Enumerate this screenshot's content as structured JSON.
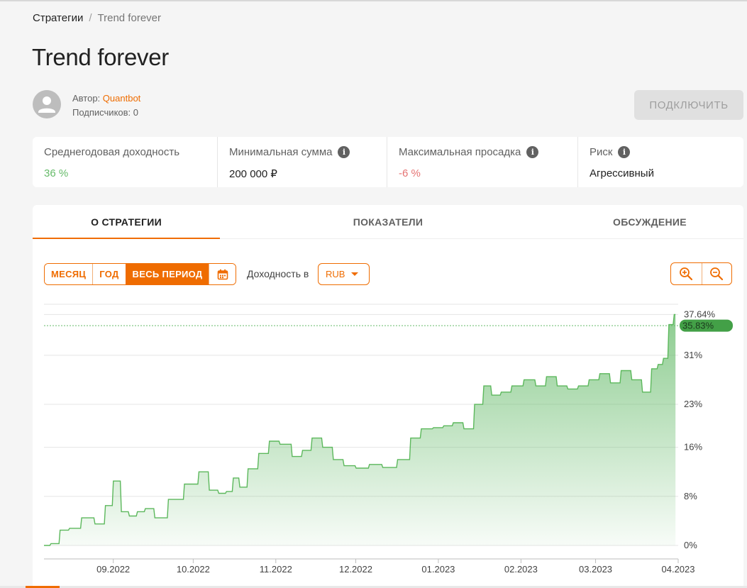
{
  "breadcrumb": {
    "parent": "Стратегии",
    "separator": "/",
    "current": "Trend forever"
  },
  "page_title": "Trend forever",
  "author": {
    "label": "Автор:",
    "name": "Quantbot",
    "subscribers_label": "Подписчиков:",
    "subscribers": "0"
  },
  "connect_button": "ПОДКЛЮЧИТЬ",
  "stats": [
    {
      "label": "Среднегодовая доходность",
      "value": "36 %",
      "info": false,
      "tone": "green"
    },
    {
      "label": "Минимальная сумма",
      "value": "200 000 ₽",
      "info": true,
      "tone": "neutral"
    },
    {
      "label": "Максимальная просадка",
      "value": "-6 %",
      "info": true,
      "tone": "red"
    },
    {
      "label": "Риск",
      "value": "Агрессивный",
      "info": true,
      "tone": "neutral"
    }
  ],
  "tabs": [
    {
      "label": "О СТРАТЕГИИ",
      "active": true
    },
    {
      "label": "ПОКАЗАТЕЛИ",
      "active": false
    },
    {
      "label": "ОБСУЖДЕНИЕ",
      "active": false
    }
  ],
  "period_buttons": [
    {
      "label": "МЕСЯЦ",
      "active": false
    },
    {
      "label": "ГОД",
      "active": false
    },
    {
      "label": "ВЕСЬ ПЕРИОД",
      "active": true
    }
  ],
  "yield_label": "Доходность в",
  "currency": {
    "selected": "RUB"
  },
  "icons": {
    "calendar": "calendar-icon",
    "zoom_in": "zoom-in-icon",
    "zoom_out": "zoom-out-icon",
    "info": "info-icon",
    "avatar": "person-icon"
  },
  "colors": {
    "accent": "#ef6c00",
    "positive": "#66bb6a",
    "negative": "#e57373",
    "line": "#66bb6a",
    "current_badge": "#43a047"
  },
  "chart_data": {
    "type": "area",
    "title": "",
    "xlabel": "",
    "ylabel": "",
    "ylim": [
      0,
      40
    ],
    "y_ticks": [
      {
        "value": 0,
        "label": "0%"
      },
      {
        "value": 8,
        "label": "8%"
      },
      {
        "value": 16,
        "label": "16%"
      },
      {
        "value": 23,
        "label": "23%"
      },
      {
        "value": 31,
        "label": "31%"
      },
      {
        "value": 37.64,
        "label": "37.64%"
      }
    ],
    "x_ticks": [
      {
        "value": "2022-09-01",
        "label": "09.2022"
      },
      {
        "value": "2022-10-01",
        "label": "10.2022"
      },
      {
        "value": "2022-11-01",
        "label": "11.2022"
      },
      {
        "value": "2022-12-01",
        "label": "12.2022"
      },
      {
        "value": "2023-01-01",
        "label": "01.2023"
      },
      {
        "value": "2023-02-01",
        "label": "02.2023"
      },
      {
        "value": "2023-03-01",
        "label": "03.2023"
      },
      {
        "value": "2023-04-01",
        "label": "04.2023"
      }
    ],
    "xlim": [
      "2022-08-06",
      "2023-04-01"
    ],
    "current": {
      "value": 35.83,
      "label": "35.83%"
    },
    "grid": true,
    "x": [
      "2022-08-06",
      "2022-08-10",
      "2022-08-13",
      "2022-08-17",
      "2022-08-22",
      "2022-08-27",
      "2022-08-30",
      "2022-09-02",
      "2022-09-05",
      "2022-09-08",
      "2022-09-11",
      "2022-09-14",
      "2022-09-18",
      "2022-09-24",
      "2022-09-30",
      "2022-10-05",
      "2022-10-08",
      "2022-10-12",
      "2022-10-14",
      "2022-10-17",
      "2022-10-19",
      "2022-10-23",
      "2022-10-27",
      "2022-10-31",
      "2022-11-04",
      "2022-11-09",
      "2022-11-12",
      "2022-11-16",
      "2022-11-20",
      "2022-11-24",
      "2022-11-28",
      "2022-12-03",
      "2022-12-08",
      "2022-12-13",
      "2022-12-19",
      "2022-12-23",
      "2022-12-27",
      "2023-01-01",
      "2023-01-04",
      "2023-01-08",
      "2023-01-12",
      "2023-01-16",
      "2023-01-19",
      "2023-01-22",
      "2023-01-26",
      "2023-01-30",
      "2023-02-04",
      "2023-02-08",
      "2023-02-12",
      "2023-02-16",
      "2023-02-20",
      "2023-02-24",
      "2023-02-28",
      "2023-03-04",
      "2023-03-08",
      "2023-03-12",
      "2023-03-16",
      "2023-03-20",
      "2023-03-23",
      "2023-03-25",
      "2023-03-27",
      "2023-03-29",
      "2023-03-31"
    ],
    "values": [
      0.0,
      0.3,
      2.5,
      2.8,
      4.5,
      3.5,
      6.5,
      10.5,
      5.5,
      4.8,
      5.5,
      6.0,
      4.5,
      7.5,
      10.0,
      12.0,
      9.0,
      8.5,
      8.8,
      11.0,
      9.5,
      12.5,
      15.0,
      17.0,
      16.5,
      14.5,
      15.5,
      17.5,
      16.0,
      14.0,
      13.0,
      12.6,
      13.2,
      12.7,
      14.0,
      17.5,
      19.0,
      19.2,
      19.5,
      20.0,
      19.0,
      23.0,
      26.0,
      24.5,
      25.0,
      26.0,
      27.0,
      26.0,
      27.5,
      26.0,
      25.5,
      26.0,
      27.0,
      28.0,
      26.5,
      28.5,
      27.0,
      25.0,
      28.8,
      29.5,
      30.5,
      36.0,
      37.64
    ]
  }
}
